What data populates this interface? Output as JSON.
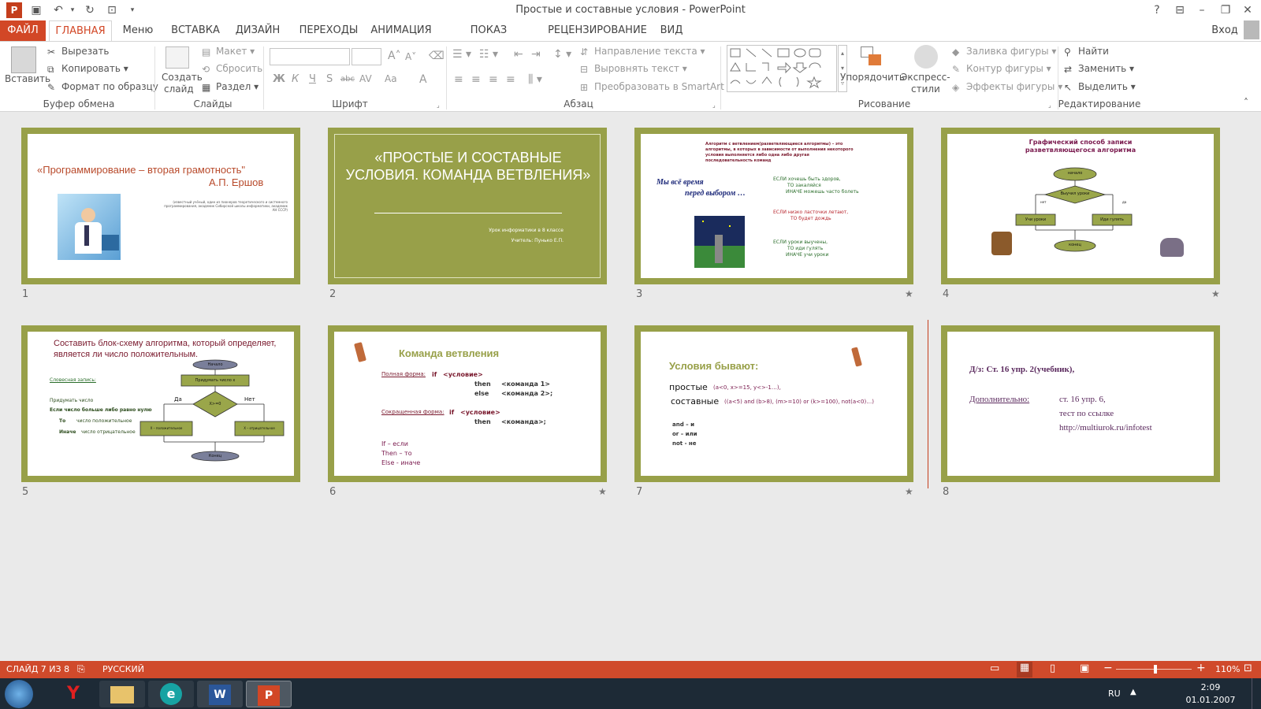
{
  "window": {
    "title": "Простые и составные условия - PowerPoint",
    "login": "Вход",
    "help": "?"
  },
  "tabs": {
    "file": "ФАЙЛ",
    "items": [
      "ГЛАВНАЯ",
      "Меню",
      "ВСТАВКА",
      "ДИЗАЙН",
      "ПЕРЕХОДЫ",
      "АНИМАЦИЯ",
      "ПОКАЗ СЛАЙДОВ",
      "РЕЦЕНЗИРОВАНИЕ",
      "ВИД"
    ]
  },
  "ribbon": {
    "clipboard": {
      "paste": "Вставить",
      "cut": "Вырезать",
      "copy": "Копировать",
      "format": "Формат по образцу",
      "label": "Буфер обмена"
    },
    "slides": {
      "new": "Создать",
      "new2": "слайд",
      "layout": "Макет",
      "reset": "Сбросить",
      "section": "Раздел",
      "label": "Слайды"
    },
    "font": {
      "label": "Шрифт",
      "bold": "Ж",
      "italic": "К",
      "underline": "Ч",
      "shadow": "S",
      "strike": "abc",
      "spacing": "AV",
      "case": "Aa",
      "color": "A"
    },
    "paragraph": {
      "label": "Абзац",
      "direction": "Направление текста",
      "align": "Выровнять текст",
      "smartart": "Преобразовать в SmartArt"
    },
    "drawing": {
      "arrange": "Упорядочить",
      "quick": "Экспресс-",
      "quick2": "стили",
      "fill": "Заливка фигуры",
      "outline": "Контур фигуры",
      "effects": "Эффекты фигуры",
      "label": "Рисование"
    },
    "editing": {
      "find": "Найти",
      "replace": "Заменить",
      "select": "Выделить",
      "label": "Редактирование"
    }
  },
  "slides": [
    {
      "num": "1",
      "title": "«Программирование – вторая грамотность\"",
      "author": "А.П. Ершов",
      "note": "(известный учёный, один из пионеров теоретического и системного программирования, академик Сибирской школы информатики, академик АН СССР)"
    },
    {
      "num": "2",
      "title": "«ПРОСТЫЕ И СОСТАВНЫЕ УСЛОВИЯ. КОМАНДА ВЕТВЛЕНИЯ»",
      "sub1": "Урок информатики в 8 классе",
      "sub2": "Учитель: Пунько Е.П."
    },
    {
      "num": "3",
      "head": "Алгоритм с ветвлением(разветвляющиеся алгоритмы) – это алгоритмы, в которых в зависимости от выполнения некоторого условия выполняется либо одна либо другая последовательность команд",
      "quote1": "Мы всё время",
      "quote2": "перед выбором …",
      "if1": "ЕСЛИ хочешь быть здоров,",
      "then1": "ТО закаляйся",
      "else1": "ИНАЧЕ можешь часто болеть",
      "if2": "ЕСЛИ низко ласточки летают,",
      "then2": "ТО будет дождь",
      "if3": "ЕСЛИ уроки выучены,",
      "then3": "ТО иди гулять",
      "else3": "ИНАЧЕ учи уроки"
    },
    {
      "num": "4",
      "title": "Графический способ записи разветвляющегося алгоритма",
      "start": "начало",
      "cond": "Выучил уроки",
      "no": "нет",
      "yes": "да",
      "left": "Учи уроки",
      "right": "Иди гулять",
      "end": "конец"
    },
    {
      "num": "5",
      "title": "Составить блок-схему алгоритма, который определяет, является ли число положительным.",
      "verbal": "Словесная запись:",
      "l1": "Придумать число",
      "l2": "Если число больше либо равно нулю",
      "l3": "То",
      "l3b": "число положительное",
      "l4": "Иначе",
      "l4b": "число отрицательное",
      "start": "Начало",
      "think": "Придумать число х",
      "cond": "Х>=0",
      "yes": "Да",
      "no": "Нет",
      "pos": "Х – положительное",
      "neg": "Х – отрицательное",
      "end": "Конец"
    },
    {
      "num": "6",
      "title": "Команда ветвления",
      "full": "Полная форма:",
      "if": "if",
      "cond": "<условие>",
      "then": "then",
      "c1": "<команда 1>",
      "else": "else",
      "c2": "<команда 2>;",
      "short": "Сокращенная форма:",
      "c": "<команда>;",
      "w1": "If –  если",
      "w2": "Then – то",
      "w3": "Else - иначе"
    },
    {
      "num": "7",
      "title": "Условия бывают:",
      "simple": "простые",
      "simple_ex": "(a<0,  x>=15, y<>-1…),",
      "compound": "составные",
      "compound_ex": "((a<5) and (b>8), (m>=10) or (k>=100), not(a<0)…)",
      "and": "and – и",
      "or": "or – или",
      "not": "not - не"
    },
    {
      "num": "8",
      "hw": "Д/з: Ст. 16 упр. 2(учебник),",
      "extra": "Дополнительно:",
      "extra2": "ст. 16 упр. 6,",
      "extra3": "тест по ссылке",
      "link": "http://multiurok.ru/infotest"
    }
  ],
  "status": {
    "slide": "СЛАЙД 7 ИЗ 8",
    "lang": "РУССКИЙ",
    "zoom": "110%"
  },
  "taskbar": {
    "lang": "RU",
    "time": "2:09",
    "date": "01.01.2007"
  }
}
